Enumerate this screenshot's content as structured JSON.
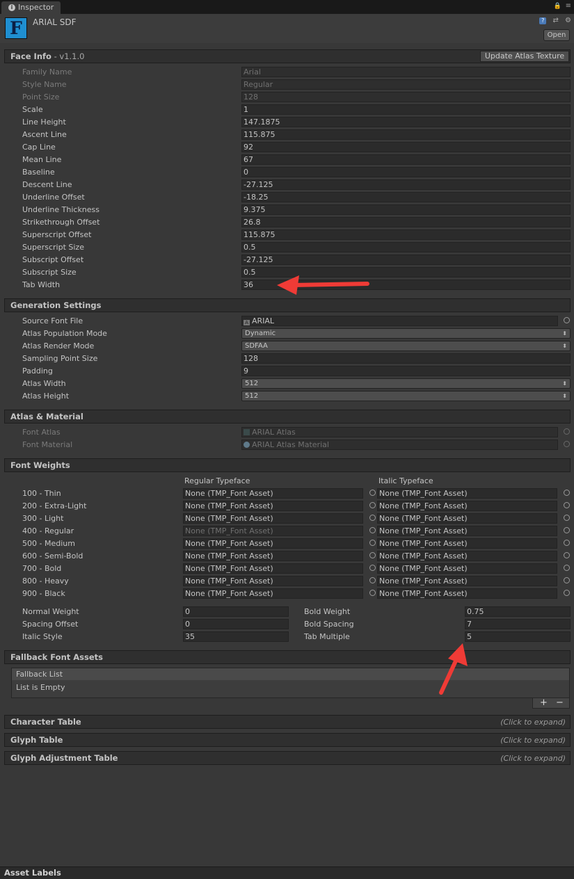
{
  "tab": {
    "title": "Inspector"
  },
  "header": {
    "asset_name": "ARIAL SDF",
    "open_label": "Open",
    "font_glyph": "F"
  },
  "face_info": {
    "title": "Face Info",
    "version": " - v1.1.0",
    "update_button": "Update Atlas Texture",
    "rows": [
      {
        "label": "Family Name",
        "value": "Arial"
      },
      {
        "label": "Style Name",
        "value": "Regular"
      },
      {
        "label": "Point Size",
        "value": "128"
      },
      {
        "label": "Scale",
        "value": "1"
      },
      {
        "label": "Line Height",
        "value": "147.1875"
      },
      {
        "label": "Ascent Line",
        "value": "115.875"
      },
      {
        "label": "Cap Line",
        "value": "92"
      },
      {
        "label": "Mean Line",
        "value": "67"
      },
      {
        "label": "Baseline",
        "value": "0"
      },
      {
        "label": "Descent Line",
        "value": "-27.125"
      },
      {
        "label": "Underline Offset",
        "value": "-18.25"
      },
      {
        "label": "Underline Thickness",
        "value": "9.375"
      },
      {
        "label": "Strikethrough Offset",
        "value": "26.8"
      },
      {
        "label": "Superscript Offset",
        "value": "115.875"
      },
      {
        "label": "Superscript Size",
        "value": "0.5"
      },
      {
        "label": "Subscript Offset",
        "value": "-27.125"
      },
      {
        "label": "Subscript Size",
        "value": "0.5"
      },
      {
        "label": "Tab Width",
        "value": "36"
      }
    ]
  },
  "generation": {
    "title": "Generation Settings",
    "source_font_label": "Source Font File",
    "source_font_value": "ARIAL",
    "population_label": "Atlas Population Mode",
    "population_value": "Dynamic",
    "render_label": "Atlas Render Mode",
    "render_value": "SDFAA",
    "sampling_label": "Sampling Point Size",
    "sampling_value": "128",
    "padding_label": "Padding",
    "padding_value": "9",
    "width_label": "Atlas Width",
    "width_value": "512",
    "height_label": "Atlas Height",
    "height_value": "512"
  },
  "atlas_material": {
    "title": "Atlas & Material",
    "atlas_label": "Font Atlas",
    "atlas_value": "ARIAL Atlas",
    "material_label": "Font Material",
    "material_value": "ARIAL Atlas Material"
  },
  "font_weights": {
    "title": "Font Weights",
    "regular_header": "Regular Typeface",
    "italic_header": "Italic Typeface",
    "rows": [
      {
        "label": "100 - Thin",
        "regular": "None (TMP_Font Asset)",
        "italic": "None (TMP_Font Asset)"
      },
      {
        "label": "200 - Extra-Light",
        "regular": "None (TMP_Font Asset)",
        "italic": "None (TMP_Font Asset)"
      },
      {
        "label": "300 - Light",
        "regular": "None (TMP_Font Asset)",
        "italic": "None (TMP_Font Asset)"
      },
      {
        "label": "400 - Regular",
        "regular": "None (TMP_Font Asset)",
        "italic": "None (TMP_Font Asset)"
      },
      {
        "label": "500 - Medium",
        "regular": "None (TMP_Font Asset)",
        "italic": "None (TMP_Font Asset)"
      },
      {
        "label": "600 - Semi-Bold",
        "regular": "None (TMP_Font Asset)",
        "italic": "None (TMP_Font Asset)"
      },
      {
        "label": "700 - Bold",
        "regular": "None (TMP_Font Asset)",
        "italic": "None (TMP_Font Asset)"
      },
      {
        "label": "800 - Heavy",
        "regular": "None (TMP_Font Asset)",
        "italic": "None (TMP_Font Asset)"
      },
      {
        "label": "900 - Black",
        "regular": "None (TMP_Font Asset)",
        "italic": "None (TMP_Font Asset)"
      }
    ],
    "normal_weight_label": "Normal Weight",
    "normal_weight_value": "0",
    "bold_weight_label": "Bold Weight",
    "bold_weight_value": "0.75",
    "spacing_offset_label": "Spacing Offset",
    "spacing_offset_value": "0",
    "bold_spacing_label": "Bold Spacing",
    "bold_spacing_value": "7",
    "italic_style_label": "Italic Style",
    "italic_style_value": "35",
    "tab_multiple_label": "Tab Multiple",
    "tab_multiple_value": "5"
  },
  "fallback": {
    "title": "Fallback Font Assets",
    "list_header": "Fallback List",
    "empty_text": "List is Empty",
    "add": "+",
    "remove": "−"
  },
  "collapsed": {
    "character_table": "Character Table",
    "glyph_table": "Glyph Table",
    "glyph_adjustment": "Glyph Adjustment Table",
    "expand_hint": "(Click to expand)"
  },
  "footer": {
    "asset_labels": "Asset Labels"
  },
  "colors": {
    "annotation_arrow": "#ef3b36",
    "font_icon": "#1f8fd1"
  }
}
